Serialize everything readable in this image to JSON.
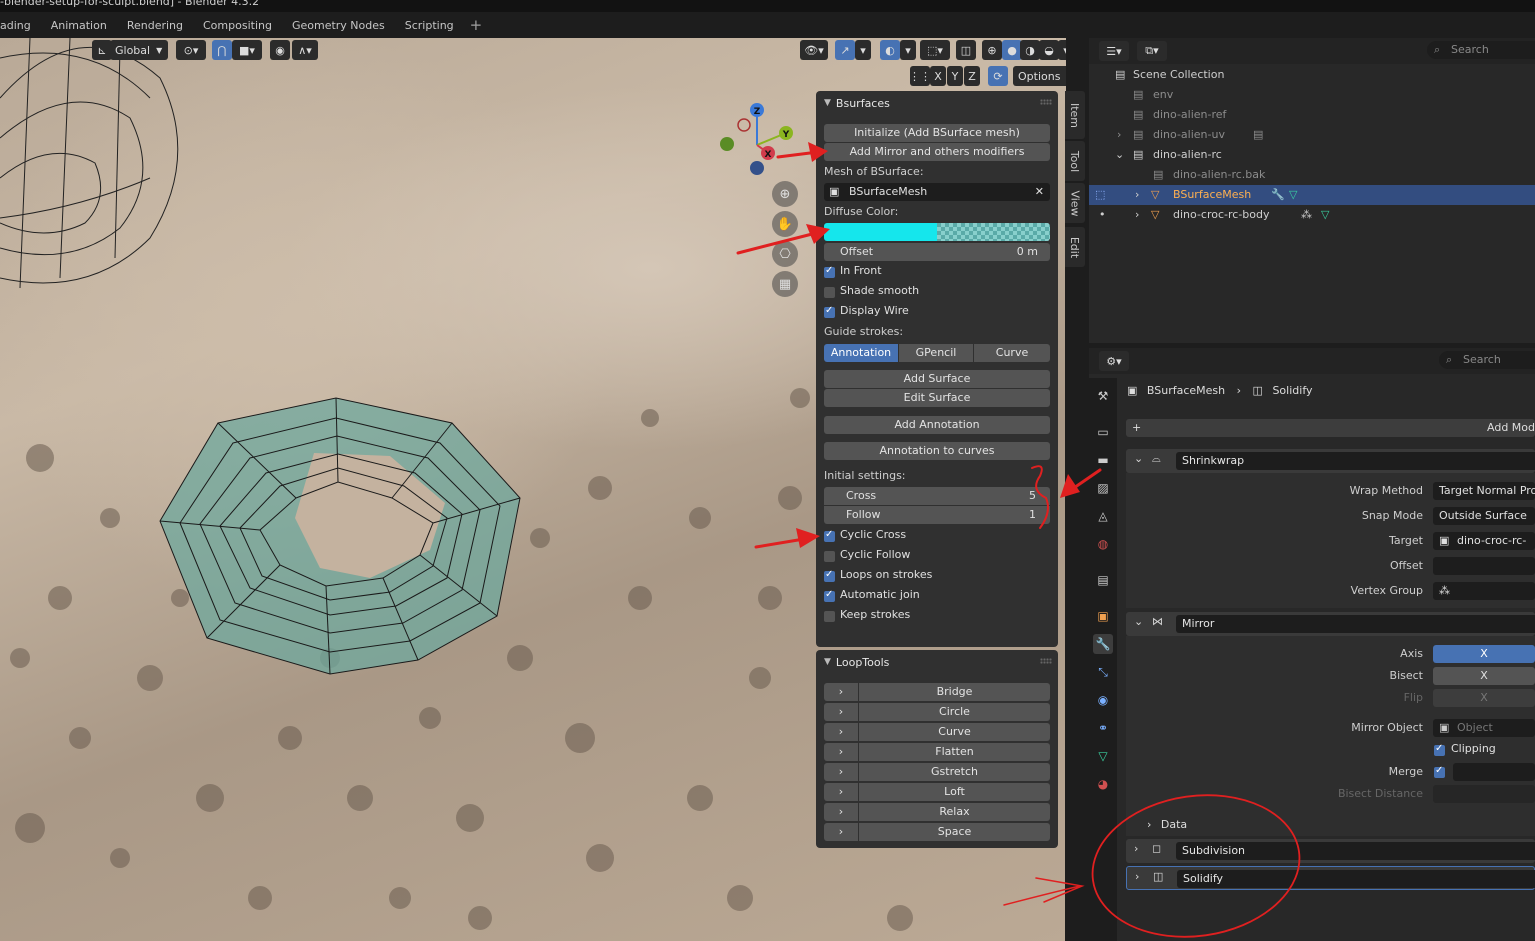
{
  "window": {
    "title": "-blender-setup-for-sculpt.blend] - Blender 4.3.2"
  },
  "workspace_tabs": [
    "ading",
    "Animation",
    "Rendering",
    "Compositing",
    "Geometry Nodes",
    "Scripting"
  ],
  "viewport_header": {
    "orientation": "Global",
    "options_label": "Options",
    "axes": [
      "X",
      "Y",
      "Z"
    ]
  },
  "gizmo": {
    "z": "Z",
    "y": "Y",
    "x": "X"
  },
  "npanel_tabs": [
    "Item",
    "Tool",
    "View",
    "Edit"
  ],
  "bsurfaces": {
    "title": "Bsurfaces",
    "initialize_btn": "Initialize (Add BSurface mesh)",
    "mirror_btn": "Add Mirror and others modifiers",
    "mesh_label": "Mesh of BSurface:",
    "mesh_value": "BSurfaceMesh",
    "diffuse_label": "Diffuse Color:",
    "diffuse_color": "#15e6ec",
    "offset_label": "Offset",
    "offset_value": "0 m",
    "in_front": {
      "label": "In Front",
      "checked": true
    },
    "shade_smooth": {
      "label": "Shade smooth",
      "checked": false
    },
    "display_wire": {
      "label": "Display Wire",
      "checked": true
    },
    "guide_label": "Guide strokes:",
    "guide_options": [
      "Annotation",
      "GPencil",
      "Curve"
    ],
    "guide_selected": "Annotation",
    "add_surface": "Add Surface",
    "edit_surface": "Edit Surface",
    "add_annotation": "Add Annotation",
    "annotation_to_curves": "Annotation to curves",
    "initial_label": "Initial settings:",
    "cross_label": "Cross",
    "cross_value": "5",
    "follow_label": "Follow",
    "follow_value": "1",
    "cyclic_cross": {
      "label": "Cyclic Cross",
      "checked": true
    },
    "cyclic_follow": {
      "label": "Cyclic Follow",
      "checked": false
    },
    "loops_on_strokes": {
      "label": "Loops on strokes",
      "checked": true
    },
    "automatic_join": {
      "label": "Automatic join",
      "checked": true
    },
    "keep_strokes": {
      "label": "Keep strokes",
      "checked": false
    }
  },
  "looptools": {
    "title": "LoopTools",
    "items": [
      "Bridge",
      "Circle",
      "Curve",
      "Flatten",
      "Gstretch",
      "Loft",
      "Relax",
      "Space"
    ]
  },
  "outliner": {
    "search_placeholder": "Search",
    "rows": [
      {
        "label": "Scene Collection"
      },
      {
        "label": "env"
      },
      {
        "label": "dino-alien-ref"
      },
      {
        "label": "dino-alien-uv"
      },
      {
        "label": "dino-alien-rc"
      },
      {
        "label": "dino-alien-rc.bak"
      },
      {
        "label": "BSurfaceMesh"
      },
      {
        "label": "dino-croc-rc-body"
      }
    ]
  },
  "properties": {
    "search_placeholder": "Search",
    "breadcrumb_object": "BSurfaceMesh",
    "breadcrumb_modifier": "Solidify",
    "add_modifier": "Add Mod",
    "shrinkwrap": {
      "name": "Shrinkwrap",
      "wrap_method_label": "Wrap Method",
      "wrap_method_value": "Target Normal Pro",
      "snap_mode_label": "Snap Mode",
      "snap_mode_value": "Outside Surface",
      "target_label": "Target",
      "target_value": "dino-croc-rc-",
      "offset_label": "Offset",
      "vertex_group_label": "Vertex Group"
    },
    "mirror": {
      "name": "Mirror",
      "axis_label": "Axis",
      "axis_value": "X",
      "bisect_label": "Bisect",
      "bisect_value": "X",
      "flip_label": "Flip",
      "flip_value": "X",
      "mirror_object_label": "Mirror Object",
      "mirror_object_placeholder": "Object",
      "clipping_label": "Clipping",
      "merge_label": "Merge",
      "bisect_distance_label": "Bisect Distance",
      "data_label": "Data"
    },
    "subdivision": {
      "name": "Subdivision"
    },
    "solidify": {
      "name": "Solidify"
    }
  },
  "colors": {
    "accent": "#4772b3",
    "selection_row": "#334d80",
    "annotation_red": "#e02020",
    "mesh_fill": "#6fa89e"
  }
}
